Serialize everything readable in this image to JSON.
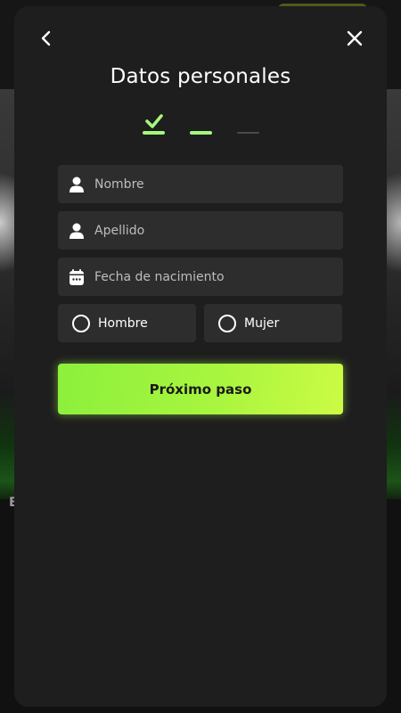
{
  "modal": {
    "title": "Datos personales",
    "back_icon": "chevron-left-icon",
    "close_icon": "close-icon"
  },
  "steps": {
    "total": 3,
    "current": 2,
    "completed": 1,
    "active_color": "#a6f77e",
    "inactive_color": "#4a4a4a"
  },
  "form": {
    "first_name": {
      "placeholder": "Nombre",
      "value": "",
      "icon": "user-icon"
    },
    "last_name": {
      "placeholder": "Apellido",
      "value": "",
      "icon": "user-icon"
    },
    "birth_date": {
      "placeholder": "Fecha de nacimiento",
      "value": "",
      "icon": "calendar-icon"
    },
    "gender": {
      "options": [
        "Hombre",
        "Mujer"
      ],
      "selected": ""
    }
  },
  "next_button": {
    "label": "Próximo paso",
    "accent_color": "#a8f53f"
  },
  "background": {
    "partial_letter": "E"
  }
}
